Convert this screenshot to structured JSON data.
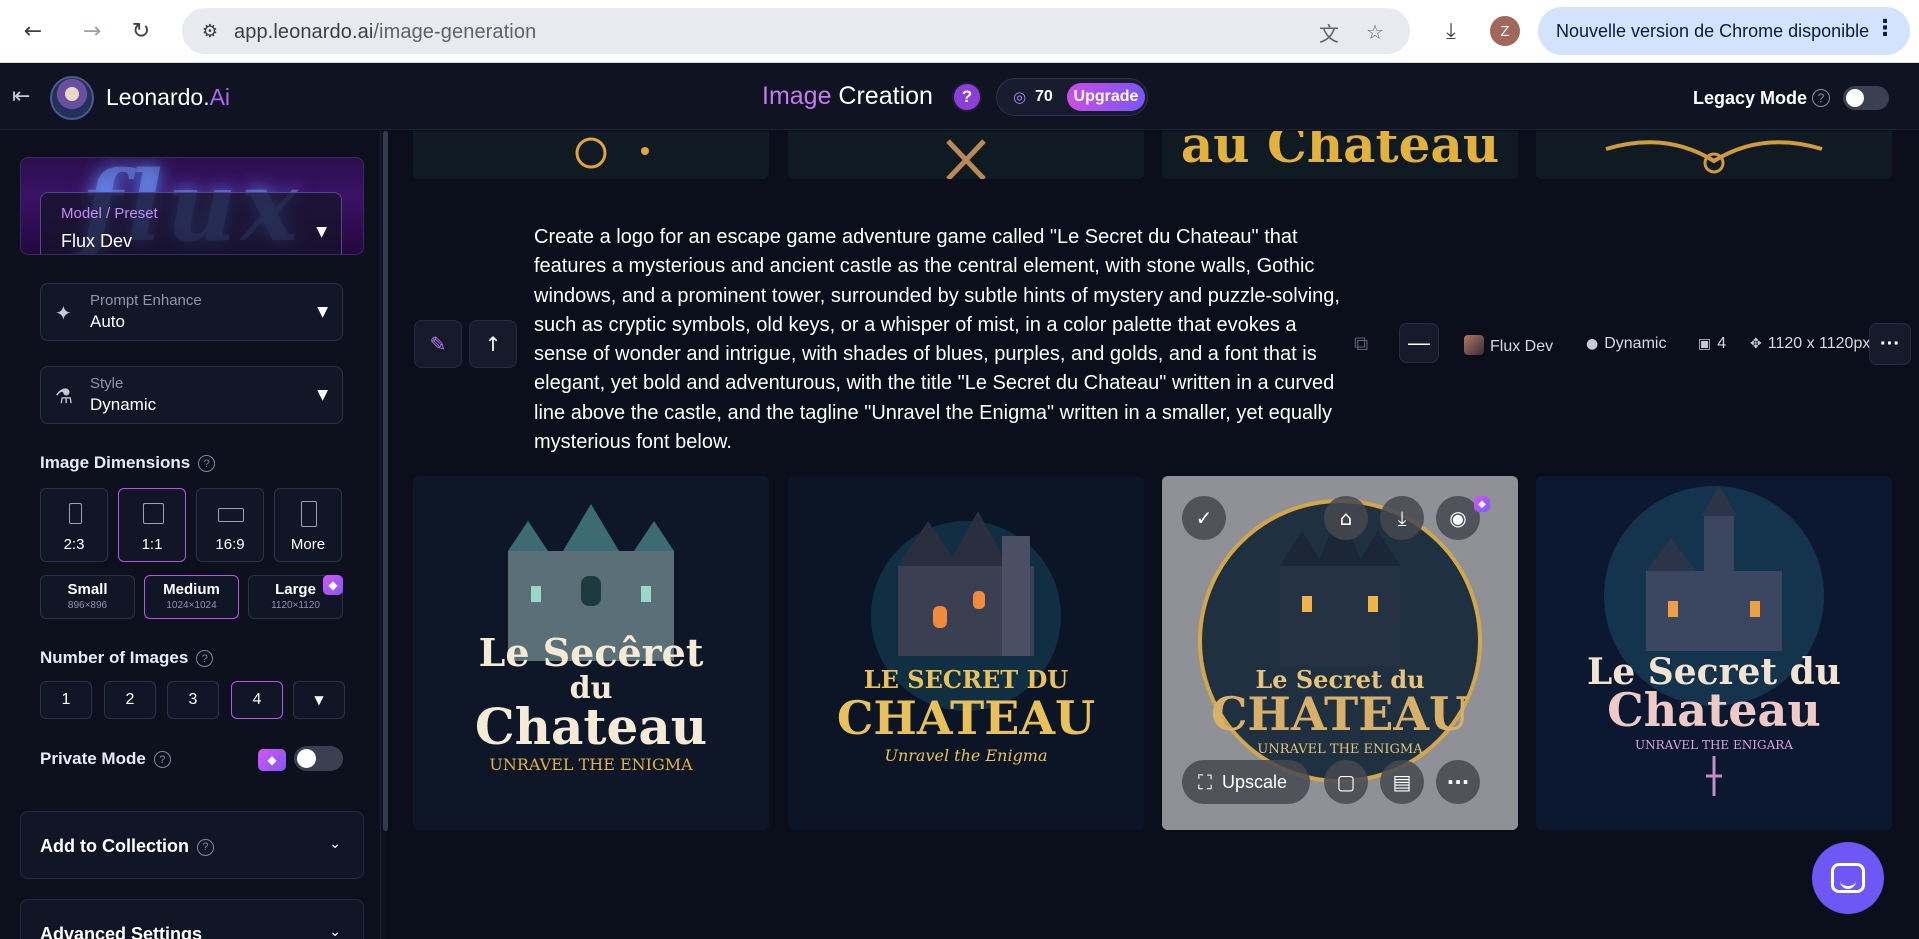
{
  "browser": {
    "url_host": "app.leonardo.ai",
    "url_path": "/image-generation",
    "profile_initial": "Z",
    "update_notice": "Nouvelle version de Chrome disponible"
  },
  "header": {
    "brand_main": "Leonardo.",
    "brand_ai": "Ai",
    "title_accent": "Image",
    "title_rest": " Creation",
    "help": "?",
    "tokens": "70",
    "upgrade": "Upgrade",
    "legacy_mode": "Legacy Mode",
    "legacy_help": "?"
  },
  "sidebar": {
    "model_label": "Model / Preset",
    "model_value": "Flux Dev",
    "model_bg_text": "flux",
    "prompt_enhance_label": "Prompt Enhance",
    "prompt_enhance_value": "Auto",
    "style_label": "Style",
    "style_value": "Dynamic",
    "image_dimensions": "Image Dimensions",
    "ratios": [
      "2:3",
      "1:1",
      "16:9",
      "More"
    ],
    "sizes": [
      {
        "name": "Small",
        "px": "896×896"
      },
      {
        "name": "Medium",
        "px": "1024×1024"
      },
      {
        "name": "Large",
        "px": "1120×1120"
      }
    ],
    "number_of_images": "Number of Images",
    "numbers": [
      "1",
      "2",
      "3",
      "4"
    ],
    "private_mode": "Private Mode",
    "add_to_collection": "Add to Collection",
    "advanced_settings": "Advanced Settings"
  },
  "main": {
    "prompt": "Create a logo for an escape game adventure game called \"Le Secret du Chateau\" that features a mysterious and ancient castle as the central element, with stone walls, Gothic windows, and a prominent tower, surrounded by subtle hints of mystery and puzzle-solving, such as cryptic symbols, old keys, or a whisper of mist, in a color palette that evokes a sense of wonder and intrigue, with shades of blues, purples, and golds, and a font that is elegant, yet bold and adventurous, with the title \"Le Secret du Chateau\" written in a curved line above the castle, and the tagline \"Unravel the Enigma\" written in a smaller, yet equally mysterious font below.",
    "meta": {
      "model": "Flux Dev",
      "style": "Dynamic",
      "count": "4",
      "dimensions": "1120 x 1120px"
    },
    "top_thumb_text": "au Chateau",
    "images": [
      {
        "line1": "Le Secêret",
        "line2": "du",
        "line3": "Chateau",
        "tagline": "UNRAVEL THE ENIGMA"
      },
      {
        "line1": "LE SECRET DU",
        "line2": "",
        "line3": "CHATEAU",
        "tagline": "Unravel the Enigma"
      },
      {
        "line1": "Le Secret du",
        "line2": "",
        "line3": "CHATEAU",
        "tagline": "UNRAVEL THE ENIGMA"
      },
      {
        "line1": "Le Secret du",
        "line2": "",
        "line3": "Chateau",
        "tagline": "UNRAVEL THE ENIGARA"
      }
    ],
    "upscale": "Upscale"
  }
}
